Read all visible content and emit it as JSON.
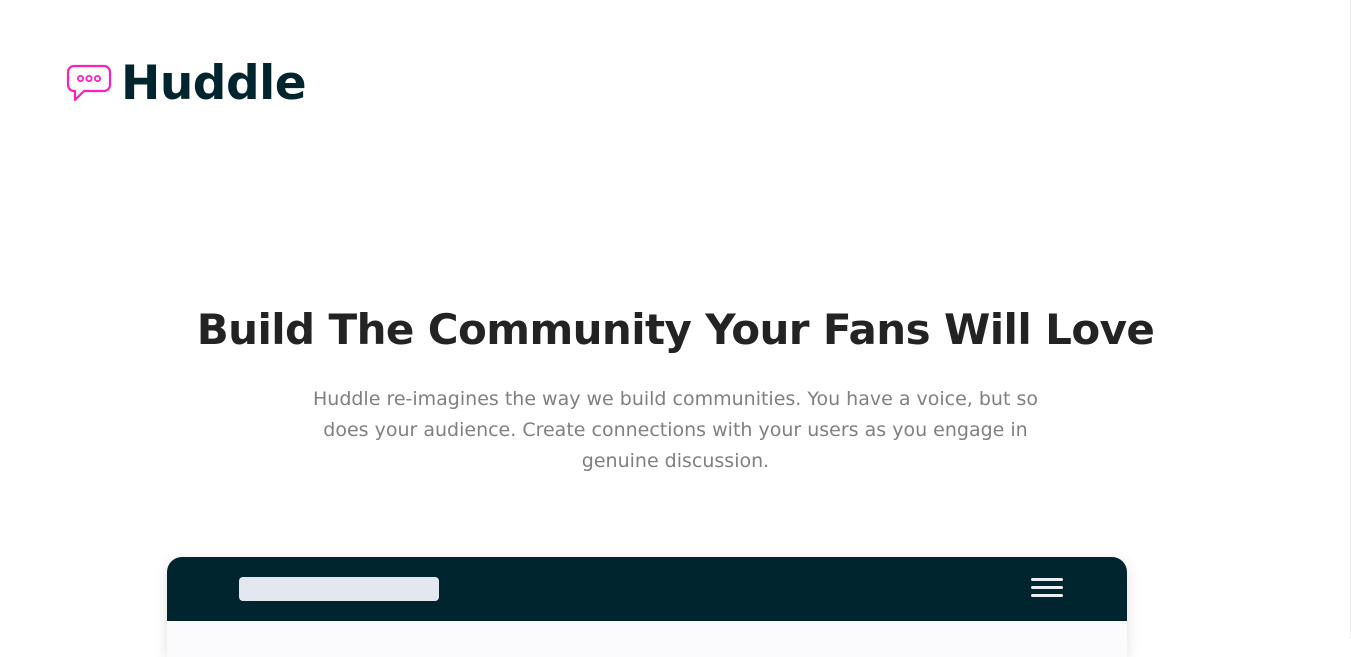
{
  "brand": {
    "name": "Huddle",
    "icon": "chat-bubble-icon",
    "icon_color": "#fa1fbe",
    "text_color": "#00252e"
  },
  "hero": {
    "title": "Build The Community Your Fans Will Love",
    "description": "Huddle re-imagines the way we build communities. You have a voice, but so does your audience. Create connections with your users as you engage in genuine discussion."
  },
  "mockup": {
    "bar_color": "#00252e",
    "search_placeholder_color": "#e3e8f0",
    "menu_icon": "hamburger-icon"
  }
}
